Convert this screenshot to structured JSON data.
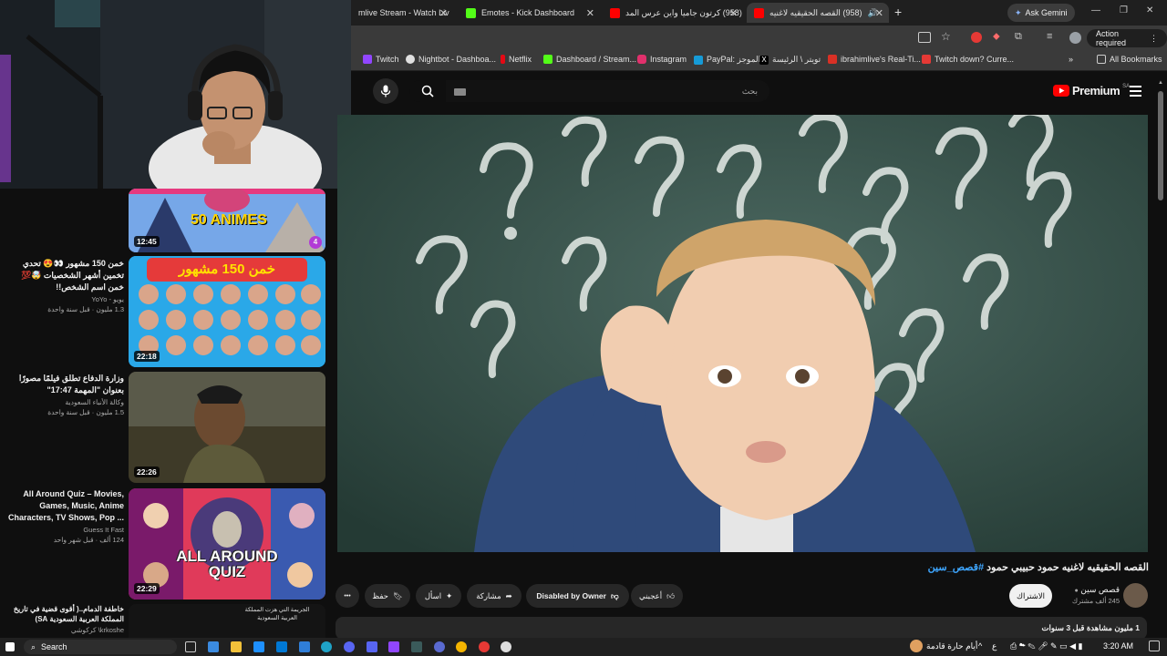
{
  "tabs": [
    {
      "title": "mlive Stream - Watch Liv",
      "fav_color": "#53fc18"
    },
    {
      "title": "Emotes - Kick Dashboard",
      "fav_color": "#53fc18"
    },
    {
      "title": "(958) كرتون جاميا واين عرس المد",
      "fav_color": "#ff0000"
    },
    {
      "title": "(958) القصه الحقيقيه لاغنيه",
      "fav_color": "#ff0000"
    }
  ],
  "browser": {
    "new_tab": "+",
    "ask_gemini": "Ask Gemini",
    "action_required": "Action required",
    "window_min": "—",
    "window_max": "❐",
    "window_close": "✕"
  },
  "bookmarks": [
    {
      "label": "Twitch",
      "color": "#9146ff"
    },
    {
      "label": "Nightbot - Dashboa...",
      "color": "#e0e0e0"
    },
    {
      "label": "Netflix",
      "color": "#e50914"
    },
    {
      "label": "Dashboard / Stream...",
      "color": "#53fc18"
    },
    {
      "label": "Instagram",
      "color": "#e1306c"
    },
    {
      "label": "PayPal: الموجز",
      "color": "#169bd7"
    },
    {
      "label": "تويتر \\ الرئيسة",
      "color": "#ffffff"
    },
    {
      "label": "ibrahimlive's Real-Ti...",
      "color": "#d93025"
    },
    {
      "label": "Twitch down? Curre...",
      "color": "#e53935"
    }
  ],
  "bookmarks_all": "All Bookmarks",
  "youtube": {
    "search_placeholder": "بحث",
    "logo_text": "Premium",
    "region": "SA"
  },
  "recommendations": [
    {
      "title": "",
      "channel": "",
      "meta": "",
      "duration": "12:45",
      "thumb_text": "50 ANIMES",
      "badge": "4"
    },
    {
      "title": "خمن 150 مشهور 👀😍 تحدي تخمين أشهر الشخصيات 🤯💯 خمن اسم الشخص!!",
      "channel": "يويو - YoYo",
      "meta": "1.3 مليون · قبل سنة واحدة",
      "duration": "22:18",
      "thumb_text": "خمن 150 مشهور"
    },
    {
      "title": "وزارة الدفاع تطلق فيلمًا مصورًا بعنوان \"المهمة 17:47\"",
      "channel": "وكالة الأنباء السعودية",
      "meta": "1.5 مليون · قبل سنة واحدة",
      "duration": "22:26",
      "thumb_text": ""
    },
    {
      "title": "All Around Quiz – Movies, Games, Music, Anime Characters, TV Shows, Pop ...",
      "channel": "Guess It Fast",
      "meta": "124 ألف · قبل شهر واحد",
      "duration": "22:29",
      "thumb_text": "ALL AROUND QUIZ"
    },
    {
      "title": "خاطفة الدمام..( أقوى قضية في تاريخ المملكة العربية السعودية SA)",
      "channel": "krkoshe\\ كركوشي",
      "meta": "",
      "duration": "",
      "thumb_text": "الجريمة التي هزت المملكة العربية السعودية"
    }
  ],
  "video": {
    "title_main": "القصه الحقيقيه لاغنيه حمود حبيبي حمود",
    "hashtag": "#قصص_سين",
    "channel_name": "قصص سين",
    "subscribers": "245 ألف مشترك",
    "subscribe_label": "الاشتراك",
    "like_label": "أعجبني",
    "dislike_label": "Disabled by Owner",
    "share_label": "مشاركة",
    "ask_label": "اسأل",
    "save_label": "حفظ",
    "more_label": "•••",
    "views_line": "1 مليون مشاهدة قبل 3 سنوات"
  },
  "taskbar": {
    "search": "Search",
    "weather": "أيام حارة قادمة",
    "lang": "ع",
    "time": "3:20 AM"
  },
  "colors": {
    "yt_red": "#ff0000",
    "chalkboard": "#2f4a44",
    "link_blue": "#3ea6ff"
  }
}
